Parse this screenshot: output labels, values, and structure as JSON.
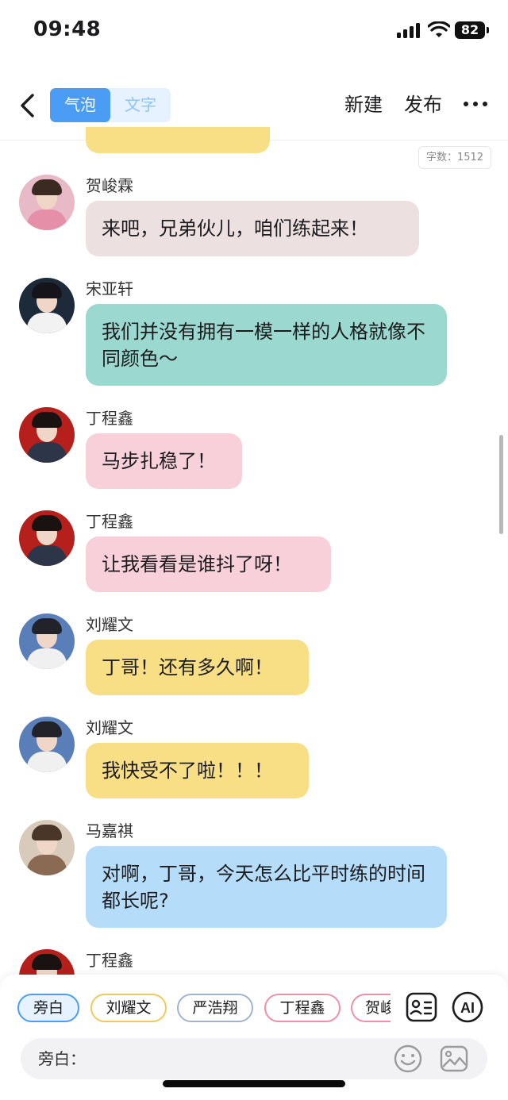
{
  "status_bar": {
    "time": "09:48",
    "battery": "82"
  },
  "nav": {
    "seg_bubble": "气泡",
    "seg_text": "文字",
    "new_label": "新建",
    "publish_label": "发布"
  },
  "word_count": "字数：1512",
  "messages": [
    {
      "name": "贺峻霖",
      "text": "来吧，兄弟伙儿，咱们练起来！",
      "color": "#ede0e0"
    },
    {
      "name": "宋亚轩",
      "text": "我们并没有拥有一模一样的人格就像不同颜色～",
      "color": "#9bd8cf"
    },
    {
      "name": "丁程鑫",
      "text": "马步扎稳了！",
      "color": "#f8d0da"
    },
    {
      "name": "丁程鑫",
      "text": "让我看看是谁抖了呀！",
      "color": "#f8d0da"
    },
    {
      "name": "刘耀文",
      "text": "丁哥！还有多久啊！",
      "color": "#f8df85"
    },
    {
      "name": "刘耀文",
      "text": "我快受不了啦！！！",
      "color": "#f8df85"
    },
    {
      "name": "马嘉祺",
      "text": "对啊，丁哥，今天怎么比平时练的时间都长呢?",
      "color": "#b5dcf8"
    },
    {
      "name": "丁程鑫",
      "text": "",
      "color": "#f8d0da"
    }
  ],
  "characters": [
    {
      "label": "旁白",
      "selected": true
    },
    {
      "label": "刘耀文",
      "color": "#f1c95a"
    },
    {
      "label": "严浩翔",
      "color": "#a0b4d0"
    },
    {
      "label": "丁程鑫",
      "color": "#ef8fa8"
    },
    {
      "label": "贺峻霖",
      "color": "#ef8fa8"
    }
  ],
  "input": {
    "label": "旁白："
  },
  "icons": {
    "back": "chevron-left-icon",
    "more": "more-dots-icon",
    "roster": "character-card-icon",
    "ai": "ai-icon",
    "emoji": "smiley-icon",
    "image": "image-icon"
  },
  "colors": {
    "accent": "#4a9cf5"
  }
}
